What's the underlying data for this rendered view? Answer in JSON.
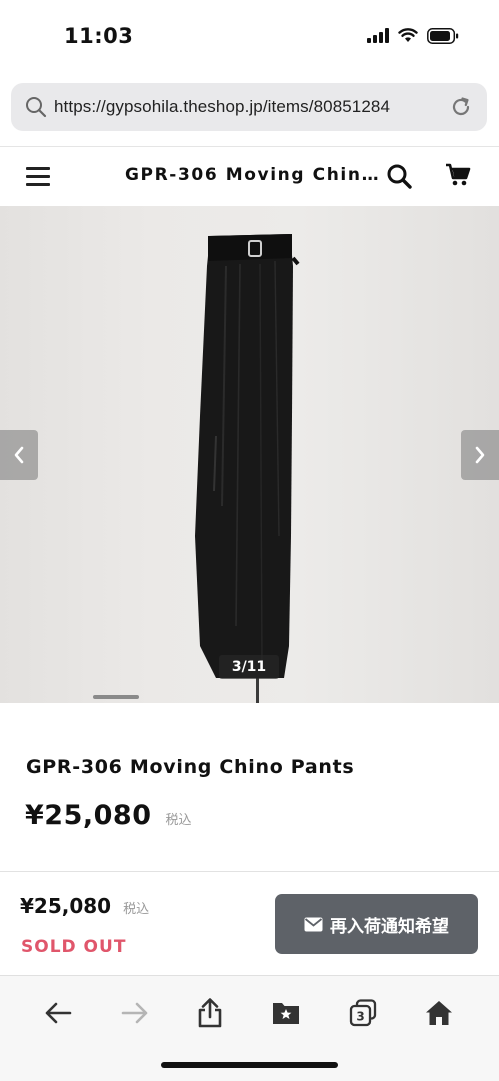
{
  "status_bar": {
    "time": "11:03",
    "icons": [
      "signal-icon",
      "wifi-icon",
      "battery-icon"
    ]
  },
  "browser": {
    "url": "https://gypsohila.theshop.jp/items/80851284",
    "icons": [
      "search-icon",
      "reload-icon"
    ]
  },
  "site_nav": {
    "title": "GPR-306 Moving Chin…",
    "icons": [
      "menu-icon",
      "search-icon",
      "cart-icon"
    ]
  },
  "gallery": {
    "counter": "3/11",
    "current": 3,
    "total": 11
  },
  "product": {
    "title": "GPR-306 Moving Chino Pants",
    "price": "¥25,080",
    "tax_label": "税込"
  },
  "purchase_bar": {
    "price": "¥25,080",
    "tax_label": "税込",
    "status": "SOLD OUT",
    "notify_label": "再入荷通知希望",
    "status_color": "#e0566b",
    "button_color": "#5e6268"
  },
  "toolbar": {
    "tab_count": "3",
    "icons": [
      "back-icon",
      "forward-icon",
      "share-icon",
      "bookmarks-icon",
      "tabs-icon",
      "home-icon"
    ]
  }
}
